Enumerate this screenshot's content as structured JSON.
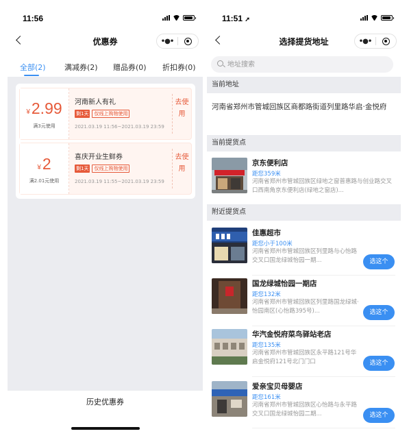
{
  "coupons_screen": {
    "time": "11:56",
    "title": "优惠券",
    "tabs": [
      {
        "label": "全部(2)"
      },
      {
        "label": "满减券(2)"
      },
      {
        "label": "赠品券(0)"
      },
      {
        "label": "折扣券(0)"
      }
    ],
    "coupons": [
      {
        "currency": "¥",
        "amount": "2.99",
        "condition": "满3元使用",
        "name": "河南新人有礼",
        "tag_solid": "剩1天",
        "tag_line": "仅线上购物使用",
        "date": "2021.03.19 11:56~2021.03.19 23:59",
        "use": "去使用"
      },
      {
        "currency": "¥",
        "amount": "2",
        "condition": "满2.01元使用",
        "name": "喜庆开业生鲜券",
        "tag_solid": "剩1天",
        "tag_line": "仅线上购物使用",
        "date": "2021.03.19 11:55~2021.03.19 23:59",
        "use": "去使用"
      }
    ],
    "history_label": "历史优惠券"
  },
  "address_screen": {
    "time": "11:51",
    "title": "选择提货地址",
    "search_placeholder": "地址搜索",
    "current_address_header": "当前地址",
    "current_address": "河南省郑州市管城回族区商都路街道列里路华启·金悦府",
    "current_pickup_header": "当前提货点",
    "current_pickup": {
      "name": "京东便利店",
      "distance": "距您359米",
      "address": "河南省郑州市管城回族区绿地之窗普惠路与创业路交叉口西南角京东便利店(绿地之窗店)..."
    },
    "nearby_header": "附近提货点",
    "pick_label": "选这个",
    "nearby": [
      {
        "name": "佳惠超市",
        "distance": "距您小于100米",
        "address": "河南省郑州市管城回族区列里路与心怡路交叉口国龙绿城怡园一期..."
      },
      {
        "name": "国龙绿城怡园一期店",
        "distance": "距您132米",
        "address": "河南省郑州市管城回族区列里路国龙绿城·怡园南区(心怡路395号)..."
      },
      {
        "name": "华汽金悦府菜鸟驿站老店",
        "distance": "距您135米",
        "address": "河南省郑州市管城回族区永平路121号华启金悦府121号北门门口"
      },
      {
        "name": "爱亲宝贝母婴店",
        "distance": "距您161米",
        "address": "河南省郑州市管城回族区心怡路与永平路交叉口国龙绿城怡园二期..."
      }
    ]
  },
  "colors": {
    "accent": "#3a8ff2",
    "coupon_red": "#e65a3a",
    "panel_bg": "#ebecf0"
  }
}
